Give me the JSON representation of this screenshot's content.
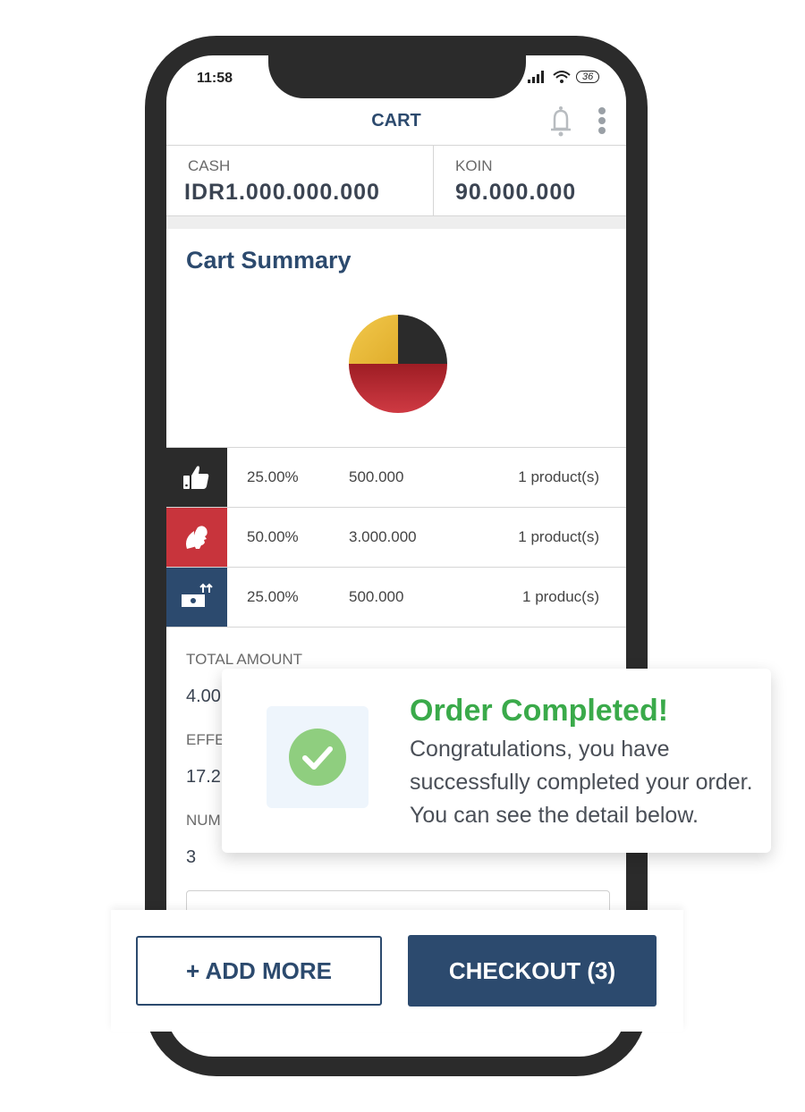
{
  "status_bar": {
    "time": "11:58",
    "battery": "36"
  },
  "header": {
    "title": "CART"
  },
  "balance": {
    "cash_label": "CASH",
    "cash_value": "IDR1.000.000.000",
    "koin_label": "KOIN",
    "koin_value": "90.000.000"
  },
  "summary": {
    "title": "Cart Summary",
    "rows": [
      {
        "icon": "thumbs-up-icon",
        "color": "#2b2b2b",
        "percent": "25.00%",
        "value": "500.000",
        "count": "1 product(s)"
      },
      {
        "icon": "face-leaf-icon",
        "color": "#c8343c",
        "percent": "50.00%",
        "value": "3.000.000",
        "count": "1 product(s)"
      },
      {
        "icon": "cash-up-icon",
        "color": "#2c4a6e",
        "percent": "25.00%",
        "value": "500.000",
        "count": "1  produc(s)"
      }
    ]
  },
  "chart_data": {
    "type": "pie",
    "values": [
      25,
      25,
      50
    ],
    "colors": [
      "#2b2b2b",
      "#f0c040",
      "#b8232b"
    ]
  },
  "details": {
    "total_label": "TOTAL AMOUNT",
    "total_value": "4.00",
    "effe_label": "EFFE",
    "effe_value": "17.2",
    "num_label": "NUM",
    "num_value": "3"
  },
  "buttons": {
    "add_more": "+ ADD MORE",
    "checkout": "CHECKOUT (3)"
  },
  "toast": {
    "title": "Order Completed!",
    "line1": "Congratulations, you have",
    "line2": "successfully completed your order.",
    "line3": "You can see the detail below."
  }
}
